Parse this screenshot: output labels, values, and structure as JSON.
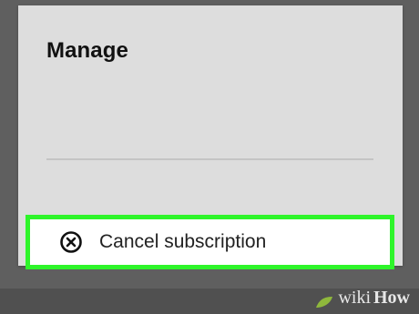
{
  "dialog": {
    "title": "Manage",
    "items": [
      {
        "label": "Cancel subscription",
        "icon": "cancel-circle-icon"
      }
    ]
  },
  "highlight_color": "#2ef52a",
  "watermark": {
    "part1": "wiki",
    "part2": "How"
  }
}
